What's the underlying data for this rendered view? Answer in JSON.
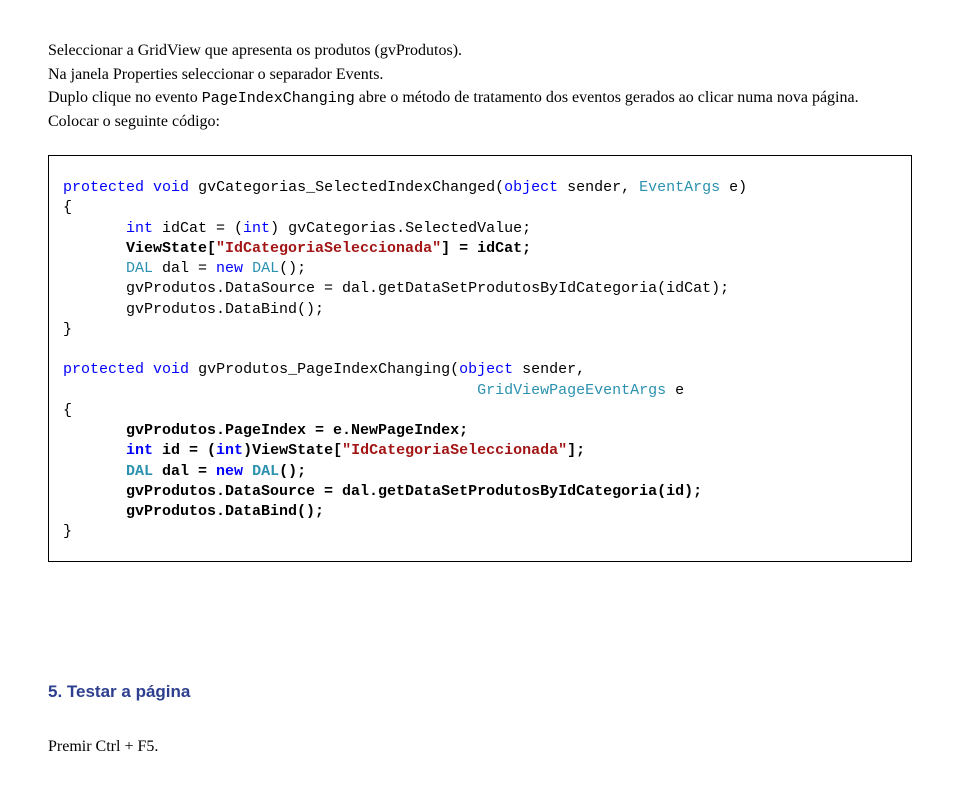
{
  "intro": {
    "p1": "Seleccionar a GridView que apresenta os produtos (gvProdutos).",
    "p2": "Na janela Properties seleccionar o separador Events.",
    "p3a": "Duplo clique no evento ",
    "p3_mono": "PageIndexChanging",
    "p3b": " abre o método de tratamento dos eventos gerados ao clicar numa nova página.",
    "p4": "Colocar o seguinte código:"
  },
  "code": {
    "protected": "protected",
    "void": "void",
    "object": "object",
    "int": "int",
    "new": "new",
    "eventargs": "EventArgs",
    "dal_type": "DAL",
    "gvpev": "GridViewPageEventArgs",
    "m1_name": "gvCategorias_SelectedIndexChanged(",
    "m1_sender": " sender, ",
    "m1_close": " e)",
    "brace_open": "{",
    "brace_close": "}",
    "m1_line1a": " idCat = (",
    "m1_line1b": ") gvCategorias.SelectedValue;",
    "m1_line2a": "ViewState[",
    "m1_line2_str": "\"IdCategoriaSeleccionada\"",
    "m1_line2b": "] = idCat;",
    "m1_line3a": " dal = ",
    "m1_line3b": "();",
    "m1_line4": "gvProdutos.DataSource = dal.getDataSetProdutosByIdCategoria(idCat);",
    "m1_line5": "gvProdutos.DataBind();",
    "m2_name": "gvProdutos_PageIndexChanging(",
    "m2_sender": " sender,",
    "m2_e": " e",
    "m2_b1": "gvProdutos.PageIndex = e.NewPageIndex;",
    "m2_b2a": " id = (",
    "m2_b2b": ")ViewState[",
    "m2_b2_str": "\"IdCategoriaSeleccionada\"",
    "m2_b2c": "];",
    "m2_b3a": " dal = ",
    "m2_b3b": "();",
    "m2_b4": "gvProdutos.DataSource = dal.getDataSetProdutosByIdCategoria(id);",
    "m2_b5": "gvProdutos.DataBind();"
  },
  "heading": "5.  Testar a página",
  "closing": "Premir Ctrl + F5."
}
